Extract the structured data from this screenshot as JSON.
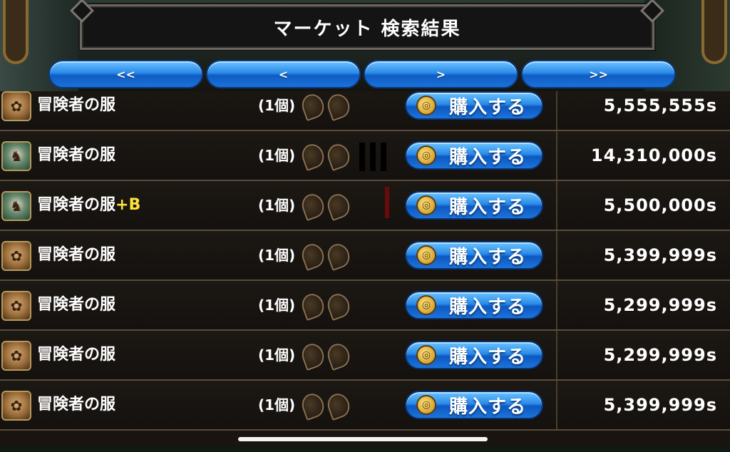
{
  "header": {
    "title": "マーケット 検索結果"
  },
  "nav": {
    "first": "<<",
    "prev": "<",
    "next": ">",
    "last": ">>"
  },
  "buy_label": "購入する",
  "rows": [
    {
      "name": "冒険者の服",
      "suffix": "",
      "qty": "(1個)",
      "price": "5,555,555s",
      "icon": "brown"
    },
    {
      "name": "冒険者の服",
      "suffix": "",
      "qty": "(1個)",
      "price": "14,310,000s",
      "icon": "green"
    },
    {
      "name": "冒険者の服",
      "suffix": "+B",
      "qty": "(1個)",
      "price": "5,500,000s",
      "icon": "green"
    },
    {
      "name": "冒険者の服",
      "suffix": "",
      "qty": "(1個)",
      "price": "5,399,999s",
      "icon": "brown"
    },
    {
      "name": "冒険者の服",
      "suffix": "",
      "qty": "(1個)",
      "price": "5,299,999s",
      "icon": "brown"
    },
    {
      "name": "冒険者の服",
      "suffix": "",
      "qty": "(1個)",
      "price": "5,299,999s",
      "icon": "brown"
    },
    {
      "name": "冒険者の服",
      "suffix": "",
      "qty": "(1個)",
      "price": "5,399,999s",
      "icon": "brown"
    }
  ],
  "colors": {
    "button_blue": "#2a8ae8",
    "suffix_yellow": "#ffe23a",
    "row_border": "#5a4c3a"
  }
}
